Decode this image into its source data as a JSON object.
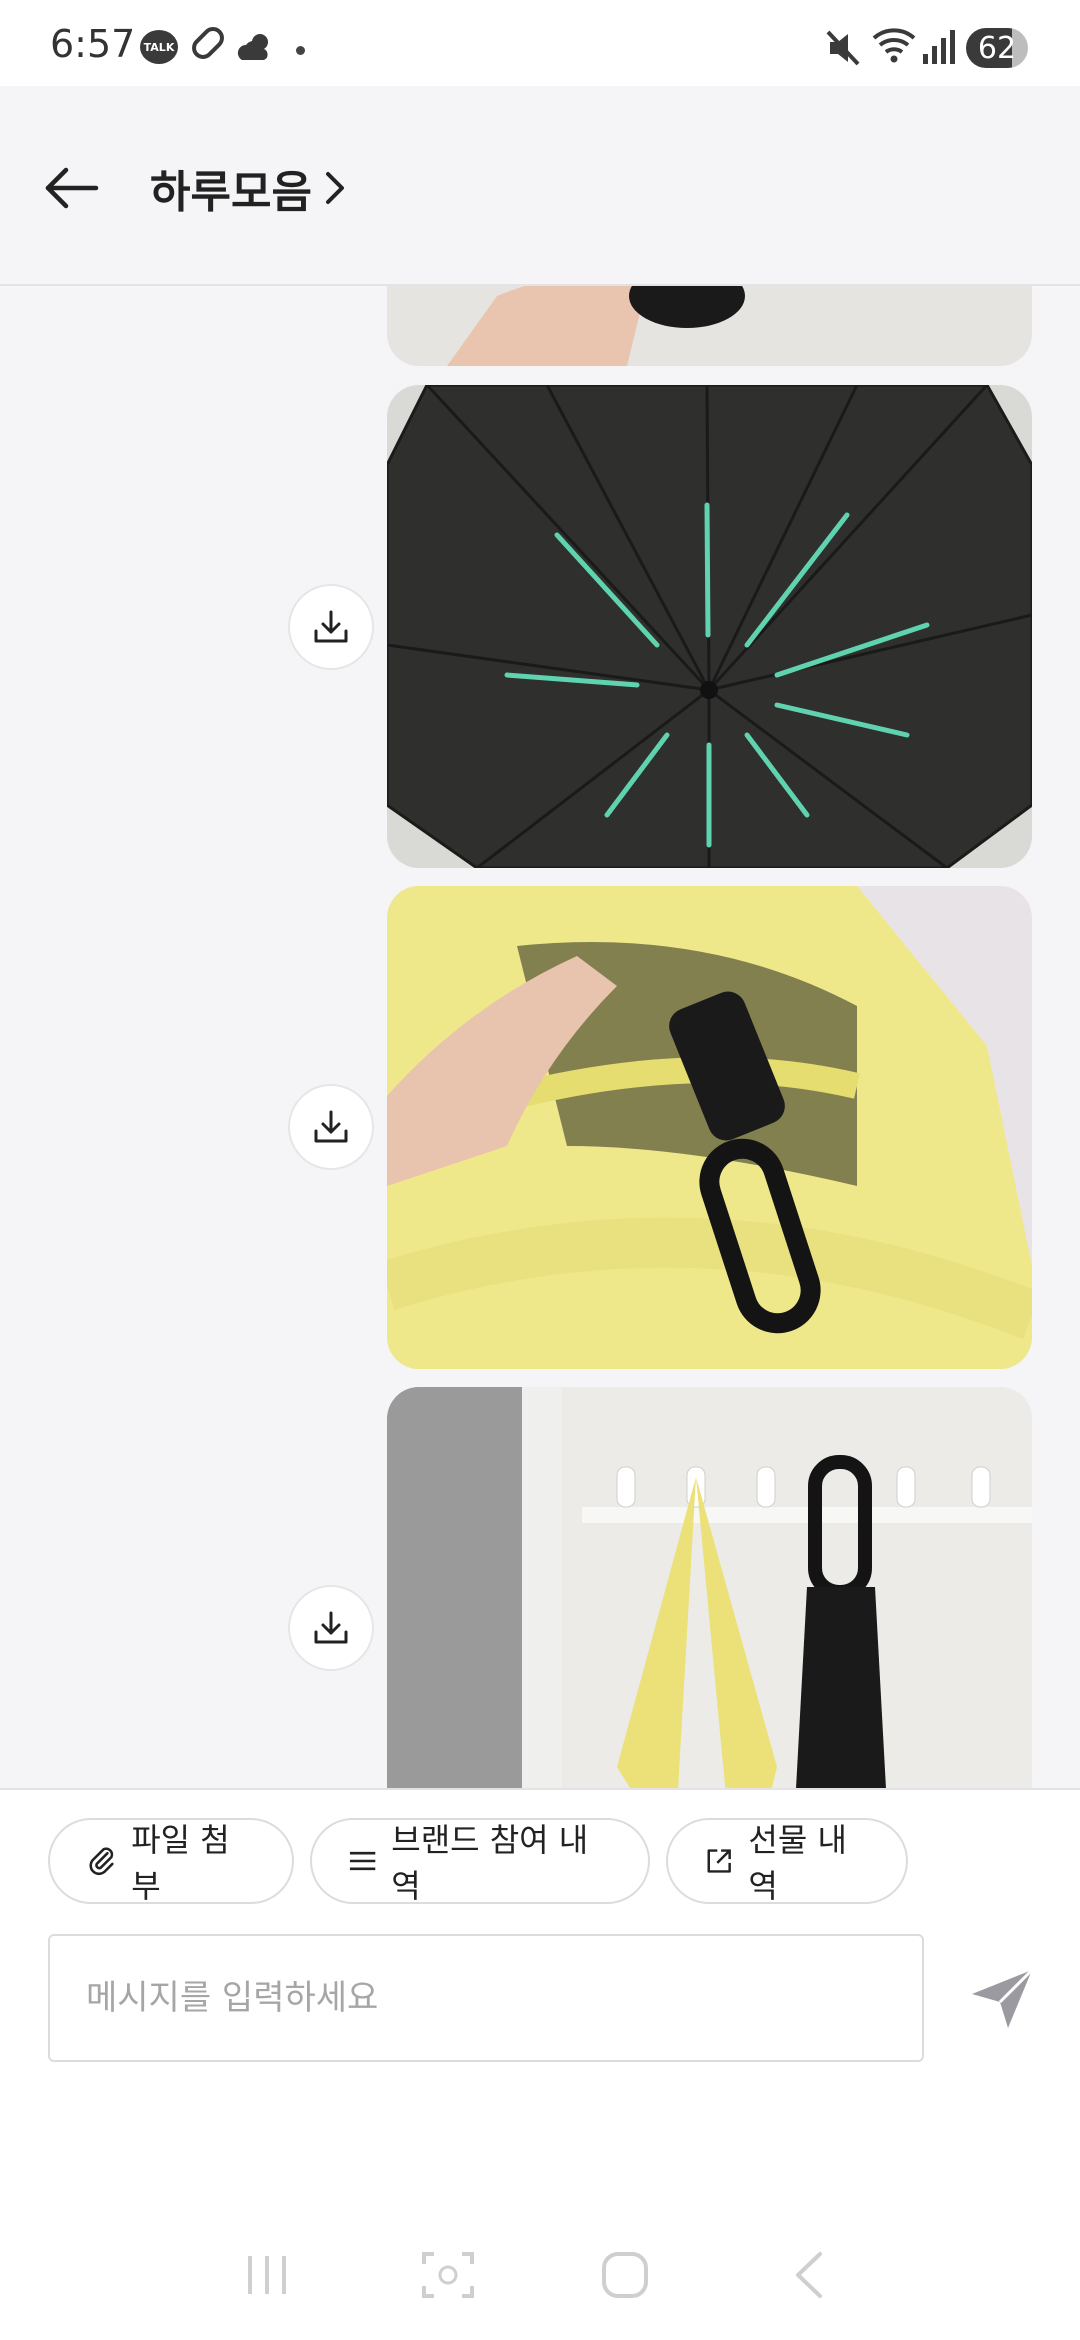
{
  "status_bar": {
    "time": "6:57",
    "talk_icon_label": "TALK",
    "battery": "62",
    "icons": [
      "talk-icon",
      "pill-icon",
      "weather-icon",
      "notification-dot-icon",
      "mute-icon",
      "wifi-icon",
      "signal-icon",
      "battery-icon"
    ]
  },
  "header": {
    "title": "하루모음",
    "back_icon": "back-arrow-icon",
    "chevron_icon": "chevron-right-icon"
  },
  "messages": {
    "items": [
      {
        "type": "image",
        "subject": "hand holding umbrella (cropped)"
      },
      {
        "type": "image",
        "subject": "open black umbrella with mint ribs",
        "download_icon": "download-icon"
      },
      {
        "type": "image",
        "subject": "folded umbrella in yellow tote bag",
        "download_icon": "download-icon"
      },
      {
        "type": "image",
        "subject": "umbrella hanging on wall hook with yellow bag",
        "download_icon": "download-icon"
      }
    ]
  },
  "actions": {
    "attach_label": "파일 첨부",
    "brand_label": "브랜드 참여 내역",
    "gift_label": "선물 내역"
  },
  "composer": {
    "placeholder": "메시지를 입력하세요",
    "value": ""
  },
  "colors": {
    "background": "#f5f5f7",
    "panel": "#ffffff",
    "accent_rib": "#5fd3b0",
    "tote_yellow": "#efe88a"
  },
  "nav": {
    "icons": [
      "recent-apps-icon",
      "screenshot-icon",
      "home-icon",
      "back-icon"
    ]
  }
}
